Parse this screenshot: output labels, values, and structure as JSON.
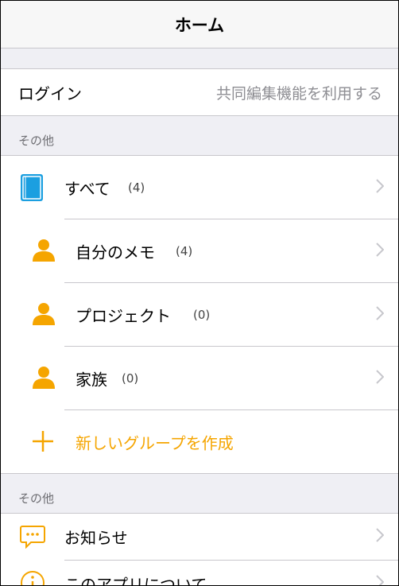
{
  "nav": {
    "title": "ホーム"
  },
  "login": {
    "label": "ログイン",
    "detail": "共同編集機能を利用する"
  },
  "section1": {
    "header": "その他",
    "items": [
      {
        "label": "すべて",
        "count": "(4)",
        "icon": "notebook-icon"
      },
      {
        "label": "自分のメモ",
        "count": "(4)",
        "icon": "person-icon"
      },
      {
        "label": "プロジェクト",
        "count": "(0)",
        "icon": "person-icon"
      },
      {
        "label": "家族",
        "count": "(0)",
        "icon": "person-icon"
      }
    ],
    "create": {
      "label": "新しいグループを作成",
      "icon": "plus-icon"
    }
  },
  "section2": {
    "header": "その他",
    "items": [
      {
        "label": "お知らせ",
        "icon": "chat-bubble-icon"
      },
      {
        "label": "このアプリについて",
        "icon": "info-icon"
      }
    ]
  },
  "colors": {
    "accent": "#f5a500",
    "notebook": "#1b9fe0",
    "separator": "#c8c7cc",
    "background": "#efeff4"
  }
}
